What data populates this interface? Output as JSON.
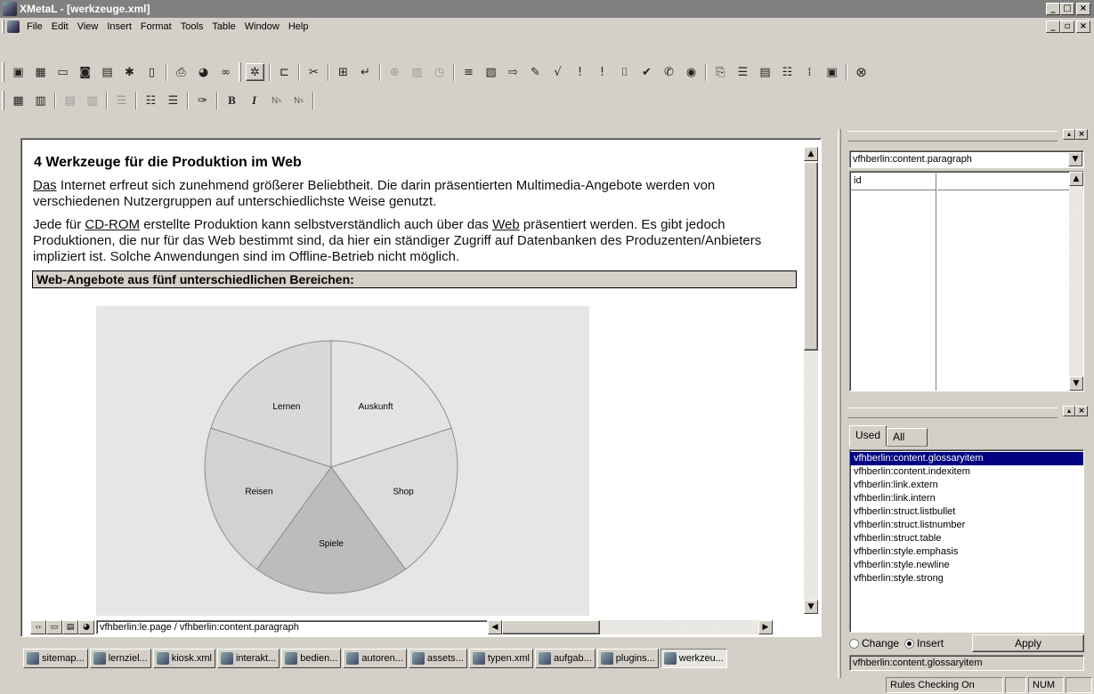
{
  "window": {
    "title": "XMetaL - [werkzeuge.xml]"
  },
  "menu": [
    "File",
    "Edit",
    "View",
    "Insert",
    "Format",
    "Tools",
    "Table",
    "Window",
    "Help"
  ],
  "toolbar2": {
    "bold": "B",
    "italic": "I",
    "sub": "Ns",
    "sup": "Ns"
  },
  "document": {
    "heading": "4 Werkzeuge für die Produktion im Web",
    "p1_link": "Das",
    "p1_rest": " Internet erfreut sich zunehmend größerer Beliebtheit. Die darin präsentierten Multimedia-Angebote werden von verschiedenen Nutzergruppen auf unterschiedlichste Weise genutzt.",
    "p2_a": "Jede für ",
    "p2_link1": "CD-ROM",
    "p2_b": " erstellte Produktion kann selbstverständlich auch über das ",
    "p2_link2": "Web",
    "p2_c": " präsentiert werden. Es gibt jedoch Produktionen, die nur für das Web bestimmt sind, da hier ein ständiger Zugriff auf Datenbanken des Produzenten/Anbieters impliziert ist. Solche Anwendungen sind im Offline-Betrieb nicht möglich.",
    "table_heading": "Web-Angebote aus fünf unterschiedlichen Bereichen:"
  },
  "chart_data": {
    "type": "pie",
    "categories": [
      "Auskunft",
      "Shop",
      "Spiele",
      "Reisen",
      "Lernen"
    ],
    "values": [
      20,
      20,
      20,
      20,
      20
    ],
    "colors": [
      "#e4e4e4",
      "#dcdcdc",
      "#bcbcbc",
      "#d2d2d2",
      "#d8d8d8"
    ]
  },
  "pathbar": {
    "path": "vfhberlin:le.page / vfhberlin:content.paragraph"
  },
  "attr_panel": {
    "element": "vfhberlin:content.paragraph",
    "attr_header": "id"
  },
  "elements_panel": {
    "tabs": [
      "Used",
      "All"
    ],
    "items": [
      "vfhberlin:content.glossaryitem",
      "vfhberlin:content.indexitem",
      "vfhberlin:link.extern",
      "vfhberlin:link.intern",
      "vfhberlin:struct.listbullet",
      "vfhberlin:struct.listnumber",
      "vfhberlin:struct.table",
      "vfhberlin:style.emphasis",
      "vfhberlin:style.newline",
      "vfhberlin:style.strong"
    ],
    "change_label": "Change",
    "insert_label": "Insert",
    "apply_label": "Apply",
    "current": "vfhberlin:content.glossaryitem"
  },
  "doc_tabs": [
    "sitemap...",
    "lernziel...",
    "kiosk.xml",
    "interakt...",
    "bedien...",
    "autoren...",
    "assets...",
    "typen.xml",
    "aufgab...",
    "plugins...",
    "werkzeu..."
  ],
  "status": {
    "rules": "Rules Checking On",
    "num": "NUM"
  }
}
